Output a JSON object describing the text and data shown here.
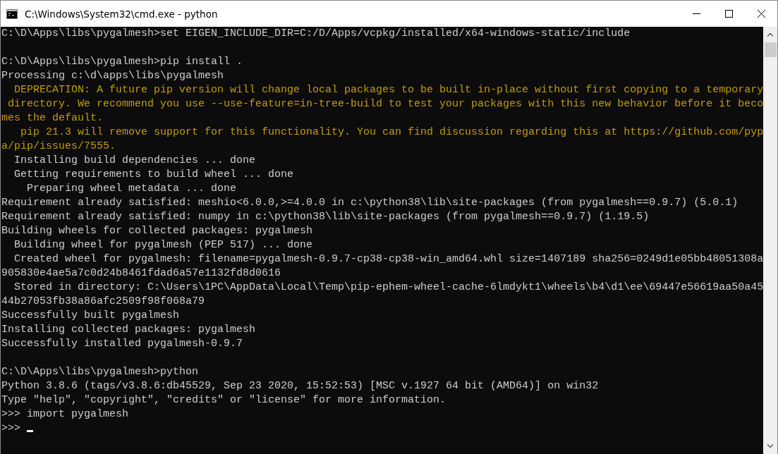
{
  "window": {
    "title": "C:\\Windows\\System32\\cmd.exe - python"
  },
  "console": {
    "lines": [
      {
        "kind": "output",
        "text": "C:\\D\\Apps\\libs\\pygalmesh>set EIGEN_INCLUDE_DIR=C:/D/Apps/vcpkg/installed/x64-windows-static/include"
      },
      {
        "kind": "blank"
      },
      {
        "kind": "output",
        "text": "C:\\D\\Apps\\libs\\pygalmesh>pip install ."
      },
      {
        "kind": "output",
        "text": "Processing c:\\d\\apps\\libs\\pygalmesh"
      },
      {
        "kind": "warning",
        "text": "  DEPRECATION: A future pip version will change local packages to be built in-place without first copying to a temporary"
      },
      {
        "kind": "warning",
        "text": " directory. We recommend you use --use-feature=in-tree-build to test your packages with this new behavior before it beco"
      },
      {
        "kind": "warning",
        "text": "mes the default."
      },
      {
        "kind": "warning",
        "text": "   pip 21.3 will remove support for this functionality. You can find discussion regarding this at https://github.com/pyp"
      },
      {
        "kind": "warning",
        "text": "a/pip/issues/7555."
      },
      {
        "kind": "output",
        "text": "  Installing build dependencies ... done"
      },
      {
        "kind": "output",
        "text": "  Getting requirements to build wheel ... done"
      },
      {
        "kind": "output",
        "text": "    Preparing wheel metadata ... done"
      },
      {
        "kind": "output",
        "text": "Requirement already satisfied: meshio<6.0.0,>=4.0.0 in c:\\python38\\lib\\site-packages (from pygalmesh==0.9.7) (5.0.1)"
      },
      {
        "kind": "output",
        "text": "Requirement already satisfied: numpy in c:\\python38\\lib\\site-packages (from pygalmesh==0.9.7) (1.19.5)"
      },
      {
        "kind": "output",
        "text": "Building wheels for collected packages: pygalmesh"
      },
      {
        "kind": "output",
        "text": "  Building wheel for pygalmesh (PEP 517) ... done"
      },
      {
        "kind": "output",
        "text": "  Created wheel for pygalmesh: filename=pygalmesh-0.9.7-cp38-cp38-win_amd64.whl size=1407189 sha256=0249d1e05bb48051308a"
      },
      {
        "kind": "output",
        "text": "905830e4ae5a7c0d24b8461fdad6a57e1132fd8d0616"
      },
      {
        "kind": "output",
        "text": "  Stored in directory: C:\\Users\\1PC\\AppData\\Local\\Temp\\pip-ephem-wheel-cache-6lmdykt1\\wheels\\b4\\d1\\ee\\69447e56619aa50a45"
      },
      {
        "kind": "output",
        "text": "44b27053fb38a86afc2509f98f068a79"
      },
      {
        "kind": "output",
        "text": "Successfully built pygalmesh"
      },
      {
        "kind": "output",
        "text": "Installing collected packages: pygalmesh"
      },
      {
        "kind": "output",
        "text": "Successfully installed pygalmesh-0.9.7"
      },
      {
        "kind": "blank"
      },
      {
        "kind": "output",
        "text": "C:\\D\\Apps\\libs\\pygalmesh>python"
      },
      {
        "kind": "output",
        "text": "Python 3.8.6 (tags/v3.8.6:db45529, Sep 23 2020, 15:52:53) [MSC v.1927 64 bit (AMD64)] on win32"
      },
      {
        "kind": "output",
        "text": "Type \"help\", \"copyright\", \"credits\" or \"license\" for more information."
      },
      {
        "kind": "output",
        "text": ">>> import pygalmesh"
      },
      {
        "kind": "prompt",
        "text": ">>>",
        "cursor": true
      }
    ]
  }
}
